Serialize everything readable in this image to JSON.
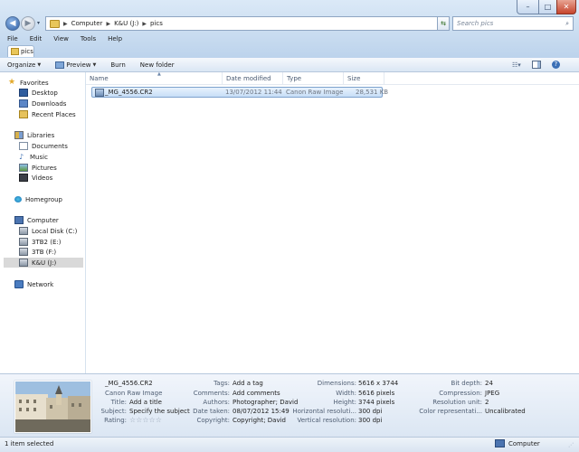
{
  "window": {
    "minimize_glyph": "–",
    "maximize_glyph": "□",
    "close_glyph": "✕"
  },
  "address": {
    "breadcrumbs": [
      "Computer",
      "K&U (J:)",
      "pics"
    ],
    "search_placeholder": "Search pics"
  },
  "menu": [
    "File",
    "Edit",
    "View",
    "Tools",
    "Help"
  ],
  "tab": {
    "label": "pics"
  },
  "toolbar": {
    "organize": "Organize",
    "preview": "Preview",
    "burn": "Burn",
    "new_folder": "New folder"
  },
  "nav": {
    "favorites": "Favorites",
    "desktop": "Desktop",
    "downloads": "Downloads",
    "recent_places": "Recent Places",
    "libraries": "Libraries",
    "documents": "Documents",
    "music": "Music",
    "pictures": "Pictures",
    "videos": "Videos",
    "homegroup": "Homegroup",
    "computer": "Computer",
    "local_disk": "Local Disk (C:)",
    "drive_e": "3TB2 (E:)",
    "drive_f": "3TB (F:)",
    "drive_j": "K&U (J:)",
    "network": "Network"
  },
  "columns": {
    "name": "Name",
    "date_modified": "Date modified",
    "type": "Type",
    "size": "Size"
  },
  "file": {
    "name": "_MG_4556.CR2",
    "date_modified": "13/07/2012 11:44",
    "type": "Canon Raw Image",
    "size": "28,531 KB"
  },
  "details": {
    "filename": "_MG_4556.CR2",
    "filetype": "Canon Raw Image",
    "title_label": "Title:",
    "title_value": "Add a title",
    "subject_label": "Subject:",
    "subject_value": "Specify the subject",
    "rating_label": "Rating:",
    "rating_value": 0,
    "rating_max": 5,
    "tags_label": "Tags:",
    "tags_value": "Add a tag",
    "comments_label": "Comments:",
    "comments_value": "Add comments",
    "authors_label": "Authors:",
    "authors_value": "Photographer; David",
    "date_taken_label": "Date taken:",
    "date_taken_value": "08/07/2012 15:49",
    "copyright_label": "Copyright:",
    "copyright_value": "Copyright; David",
    "dimensions_label": "Dimensions:",
    "dimensions_value": "5616 x 3744",
    "width_label": "Width:",
    "width_value": "5616 pixels",
    "height_label": "Height:",
    "height_value": "3744 pixels",
    "hres_label": "Horizontal resoluti...",
    "hres_value": "300 dpi",
    "vres_label": "Vertical resolution:",
    "vres_value": "300 dpi",
    "bitdepth_label": "Bit depth:",
    "bitdepth_value": "24",
    "compression_label": "Compression:",
    "compression_value": "JPEG",
    "resunit_label": "Resolution unit:",
    "resunit_value": "2",
    "colorrep_label": "Color representati...",
    "colorrep_value": "Uncalibrated"
  },
  "status": {
    "items": "1 item selected",
    "location": "Computer"
  }
}
